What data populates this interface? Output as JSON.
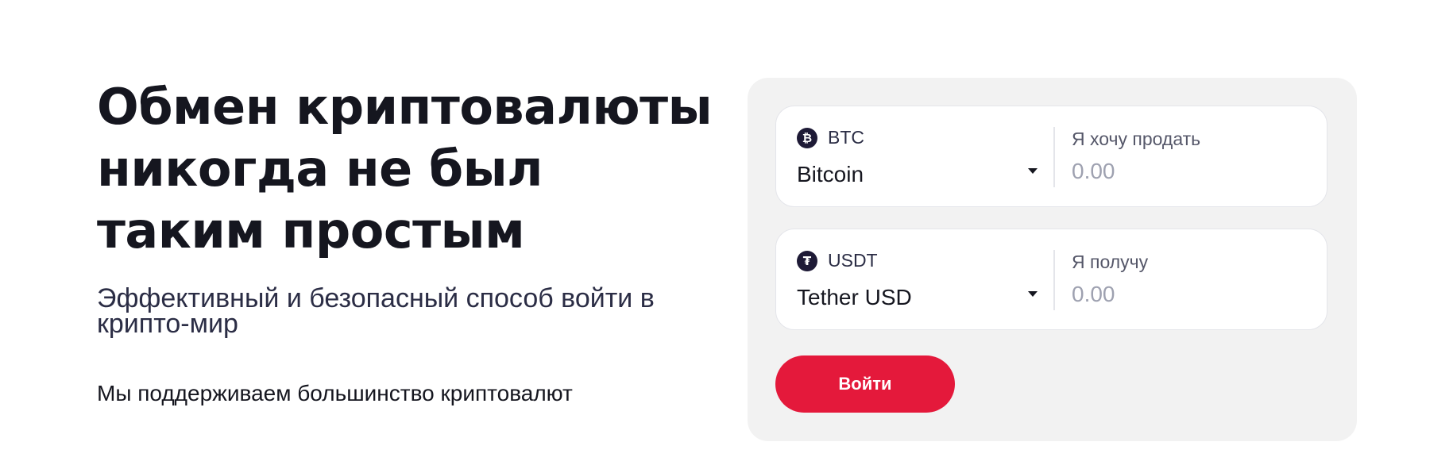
{
  "hero": {
    "title_line1": "Обмен криптовалюты",
    "title_line2": "никогда не был",
    "title_line3": "таким простым",
    "subtitle": "Эффективный и безопасный способ войти в крипто-мир",
    "note": "Мы поддерживаем большинство криптовалют"
  },
  "exchange": {
    "sell": {
      "icon": "bitcoin-icon",
      "icon_glyph": "₿",
      "ticker": "BTC",
      "name": "Bitcoin",
      "label": "Я хочу продать",
      "value": "",
      "placeholder": "0.00"
    },
    "buy": {
      "icon": "tether-icon",
      "icon_glyph": "₮",
      "ticker": "USDT",
      "name": "Tether USD",
      "label": "Я получу",
      "value": "",
      "placeholder": "0.00"
    },
    "button_label": "Войти"
  },
  "colors": {
    "accent": "#e4193b",
    "panel_background": "#f2f2f2",
    "text_primary": "#15161f",
    "placeholder": "#9ea1b0",
    "coin_icon_background": "#1e1a36"
  }
}
